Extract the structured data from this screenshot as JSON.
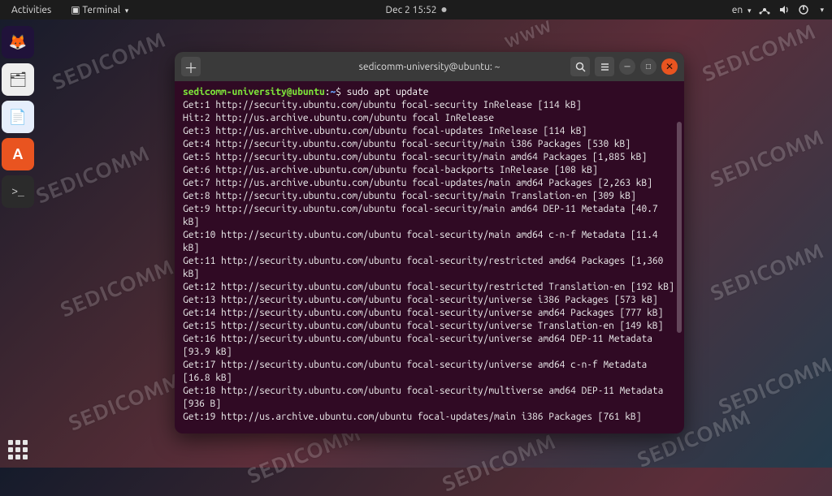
{
  "topbar": {
    "activities": "Activities",
    "app_menu": "Terminal",
    "clock": "Dec 2  15:52",
    "lang": "en"
  },
  "dock": {
    "items": [
      {
        "name": "firefox",
        "glyph": "🦊"
      },
      {
        "name": "files",
        "glyph": "🗂"
      },
      {
        "name": "document",
        "glyph": "📄"
      },
      {
        "name": "software",
        "glyph": "A"
      },
      {
        "name": "terminal",
        "glyph": ">_"
      }
    ]
  },
  "window": {
    "title": "sedicomm-university@ubuntu: ~",
    "prompt_user_host": "sedicomm-university@ubuntu",
    "prompt_path": "~",
    "command": "sudo apt update",
    "output_lines": [
      "Get:1 http://security.ubuntu.com/ubuntu focal-security InRelease [114 kB]",
      "Hit:2 http://us.archive.ubuntu.com/ubuntu focal InRelease",
      "Get:3 http://us.archive.ubuntu.com/ubuntu focal-updates InRelease [114 kB]",
      "Get:4 http://security.ubuntu.com/ubuntu focal-security/main i386 Packages [530 kB]",
      "Get:5 http://security.ubuntu.com/ubuntu focal-security/main amd64 Packages [1,885 kB]",
      "Get:6 http://us.archive.ubuntu.com/ubuntu focal-backports InRelease [108 kB]",
      "Get:7 http://us.archive.ubuntu.com/ubuntu focal-updates/main amd64 Packages [2,263 kB]",
      "Get:8 http://security.ubuntu.com/ubuntu focal-security/main Translation-en [309 kB]",
      "Get:9 http://security.ubuntu.com/ubuntu focal-security/main amd64 DEP-11 Metadata [40.7 kB]",
      "Get:10 http://security.ubuntu.com/ubuntu focal-security/main amd64 c-n-f Metadata [11.4 kB]",
      "Get:11 http://security.ubuntu.com/ubuntu focal-security/restricted amd64 Packages [1,360 kB]",
      "Get:12 http://security.ubuntu.com/ubuntu focal-security/restricted Translation-en [192 kB]",
      "Get:13 http://security.ubuntu.com/ubuntu focal-security/universe i386 Packages [573 kB]",
      "Get:14 http://security.ubuntu.com/ubuntu focal-security/universe amd64 Packages [777 kB]",
      "Get:15 http://security.ubuntu.com/ubuntu focal-security/universe Translation-en [149 kB]",
      "Get:16 http://security.ubuntu.com/ubuntu focal-security/universe amd64 DEP-11 Metadata [93.9 kB]",
      "Get:17 http://security.ubuntu.com/ubuntu focal-security/universe amd64 c-n-f Metadata [16.8 kB]",
      "Get:18 http://security.ubuntu.com/ubuntu focal-security/multiverse amd64 DEP-11 Metadata [936 B]",
      "Get:19 http://us.archive.ubuntu.com/ubuntu focal-updates/main i386 Packages [761 kB]"
    ]
  },
  "watermarks": [
    "SEDICOMM",
    "SEDICOMM",
    "SEDICOMM",
    "SEDICOMM",
    "SEDICOMM",
    "SEDICOMM",
    "SEDICOMM",
    "SEDICOMM",
    "SEDICOMM",
    "SEDICOMM",
    "WWW",
    "SEDICOMM"
  ]
}
